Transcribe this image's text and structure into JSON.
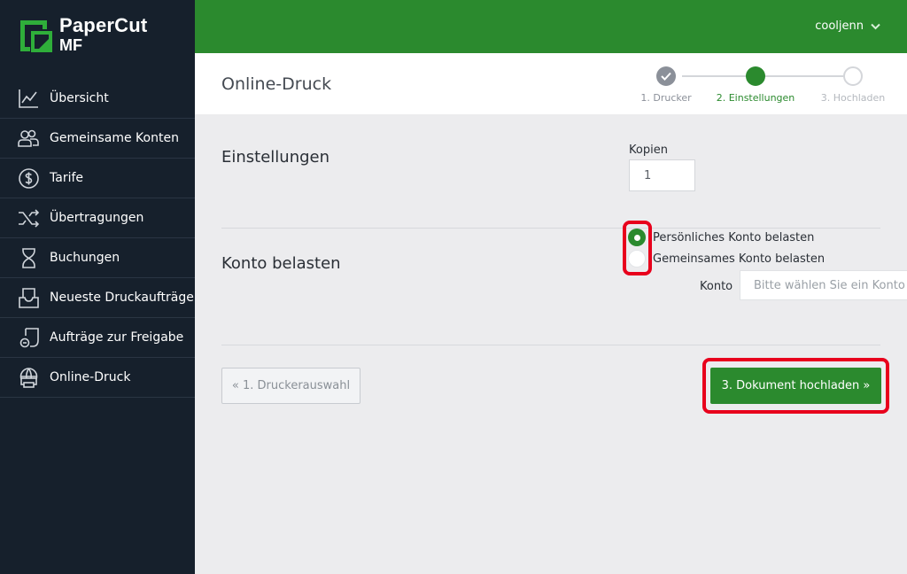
{
  "brand": {
    "name_line1": "PaperCut",
    "name_line2": "MF",
    "logo_color": "#2fae3a"
  },
  "sidebar": {
    "items": [
      {
        "label": "Übersicht",
        "icon": "chart-line-icon"
      },
      {
        "label": "Gemeinsame Konten",
        "icon": "users-icon"
      },
      {
        "label": "Tarife",
        "icon": "dollar-circle-icon"
      },
      {
        "label": "Übertragungen",
        "icon": "shuffle-icon"
      },
      {
        "label": "Buchungen",
        "icon": "hourglass-icon"
      },
      {
        "label": "Neueste Druckaufträge",
        "icon": "inbox-tray-icon"
      },
      {
        "label": "Aufträge zur Freigabe",
        "icon": "print-release-icon"
      },
      {
        "label": "Online-Druck",
        "icon": "web-print-icon"
      }
    ]
  },
  "topbar": {
    "user": "cooljenn",
    "color": "#2b8a2e"
  },
  "header": {
    "title": "Online-Druck",
    "steps": [
      {
        "label": "1. Drucker",
        "state": "done"
      },
      {
        "label": "2. Einstellungen",
        "state": "active"
      },
      {
        "label": "3. Hochladen",
        "state": "pending"
      }
    ]
  },
  "settings": {
    "title": "Einstellungen",
    "copies_label": "Kopien",
    "copies_value": "1"
  },
  "charge": {
    "title": "Konto belasten",
    "options": [
      {
        "label": "Persönliches Konto belasten",
        "selected": true
      },
      {
        "label": "Gemeinsames Konto belasten",
        "selected": false
      }
    ],
    "account_label": "Konto",
    "account_placeholder": "Bitte wählen Sie ein Konto z"
  },
  "buttons": {
    "back": "« 1. Druckerauswahl",
    "next": "3. Dokument hochladen »"
  },
  "colors": {
    "accent": "#2b8a2e",
    "sidebar_bg": "#16202c",
    "highlight": "#e8001c"
  }
}
